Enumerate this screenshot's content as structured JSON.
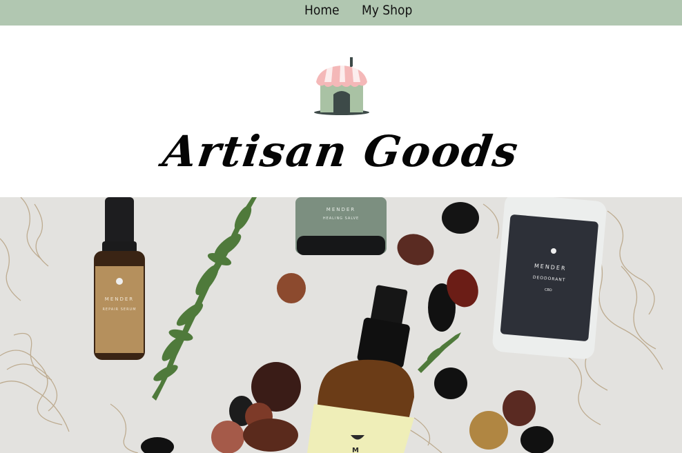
{
  "nav": {
    "items": [
      {
        "label": "Home"
      },
      {
        "label": "My Shop"
      }
    ]
  },
  "brand": {
    "title": "Artisan Goods",
    "logo_icon": "storefront-icon"
  },
  "hero": {
    "description_icon": "product-photo",
    "products": [
      {
        "brand": "MENDER",
        "name": "REPAIR SERUM"
      },
      {
        "brand": "MENDER",
        "name": "HEALING SALVE"
      },
      {
        "brand": "MENDER",
        "name": "DEODORANT",
        "sub": "CBD"
      },
      {
        "brand": "M"
      }
    ]
  },
  "colors": {
    "nav_bg": "#b1c7b1",
    "awning_pink": "#f4b8b8",
    "house_green": "#a9c2a4",
    "door_dark": "#3d4a48"
  }
}
